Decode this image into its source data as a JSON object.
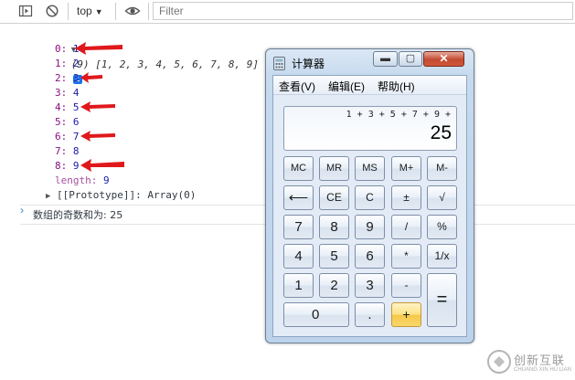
{
  "toolbar": {
    "context": "top",
    "filter_placeholder": "Filter"
  },
  "console": {
    "array_summary": "(9) [1, 2, 3, 4, 5, 6, 7, 8, 9]",
    "entries": [
      {
        "key": "0",
        "value": "1"
      },
      {
        "key": "1",
        "value": "2"
      },
      {
        "key": "2",
        "value": "3"
      },
      {
        "key": "3",
        "value": "4"
      },
      {
        "key": "4",
        "value": "5"
      },
      {
        "key": "5",
        "value": "6"
      },
      {
        "key": "6",
        "value": "7"
      },
      {
        "key": "7",
        "value": "8"
      },
      {
        "key": "8",
        "value": "9"
      }
    ],
    "length_key": "length",
    "length_value": "9",
    "prototype": "[[Prototype]]: Array(0)",
    "result_text": "数组的奇数和为: 25",
    "colors": {
      "key": "#881280",
      "value": "#1a1aa6",
      "arrow": "#e0181b",
      "prompt": "#2a86d8"
    }
  },
  "calculator": {
    "title": "计算器",
    "menu": [
      "查看(V)",
      "编辑(E)",
      "帮助(H)"
    ],
    "expression": "1 + 3 + 5 + 7 + 9 +",
    "result": "25",
    "keys": {
      "mc": "MC",
      "mr": "MR",
      "ms": "MS",
      "mplus": "M+",
      "mminus": "M-",
      "backspace": "⟵",
      "ce": "CE",
      "c": "C",
      "negate": "±",
      "sqrt": "√",
      "n7": "7",
      "n8": "8",
      "n9": "9",
      "divide": "/",
      "percent": "%",
      "n4": "4",
      "n5": "5",
      "n6": "6",
      "multiply": "*",
      "reciprocal": "1/x",
      "n1": "1",
      "n2": "2",
      "n3": "3",
      "minus": "-",
      "equals": "=",
      "n0": "0",
      "decimal": ".",
      "plus": "+"
    }
  },
  "watermark": {
    "text": "创新互联",
    "subtext": "CHUANG XIN HU LIAN"
  }
}
